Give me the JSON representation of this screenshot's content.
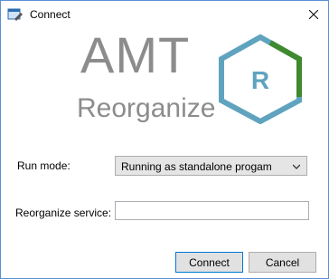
{
  "window": {
    "title": "Connect",
    "app_icon": "app-window-icon",
    "close_icon": "close-icon"
  },
  "logo": {
    "primary_text": "AMT",
    "secondary_text": "Reorganize",
    "badge_letter": "R",
    "hex_color": "#5fa3bf",
    "hex_accent_color": "#3f8a2f",
    "text_color": "#8c8c8c"
  },
  "form": {
    "run_mode_label": "Run mode:",
    "run_mode_value": "Running as standalone progam",
    "service_label": "Reorganize service:",
    "service_value": ""
  },
  "buttons": {
    "connect": "Connect",
    "cancel": "Cancel"
  }
}
